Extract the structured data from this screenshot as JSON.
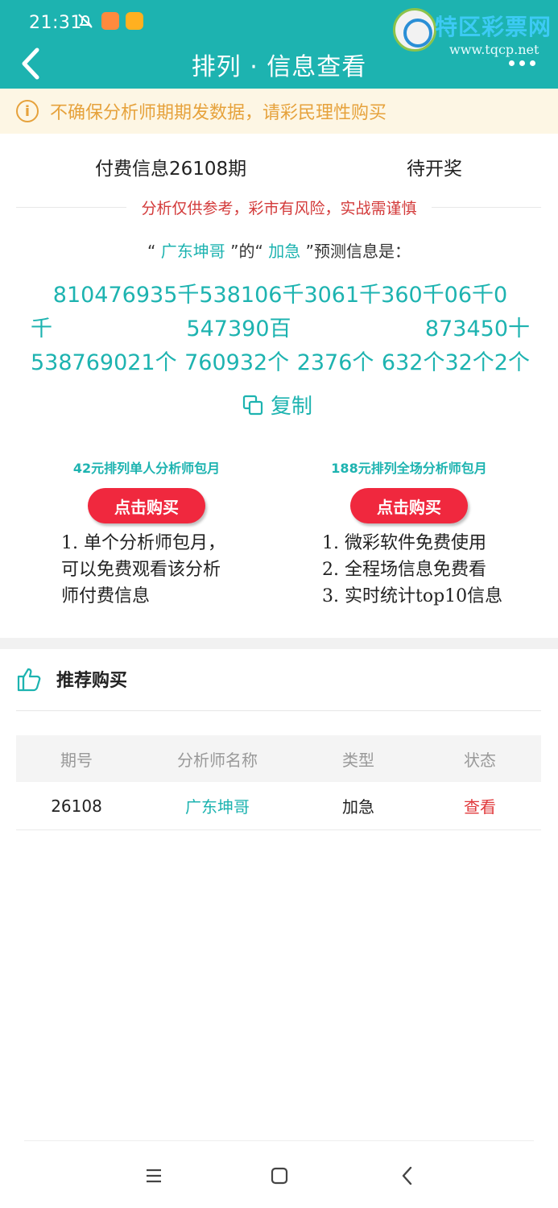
{
  "status_bar": {
    "time": "21:31"
  },
  "watermark": {
    "title": "特区彩票网",
    "url": "www.tqcp.net"
  },
  "nav": {
    "title": "排列 · 信息查看"
  },
  "notice": {
    "icon": "info-circle-icon",
    "text": "不确保分析师期期发数据，请彩民理性购买"
  },
  "info": {
    "title": "付费信息26108期",
    "status": "待开奖",
    "risk_text": "分析仅供参考，彩市有风险，实战需谨慎"
  },
  "predict": {
    "quote_open": "“",
    "analyst": "广东坤哥",
    "middle": "”的“",
    "type": "加急",
    "suffix": "”预测信息是："
  },
  "numbers": {
    "line1": [
      "810476935千538106千3061千360千06千0"
    ],
    "line2": [
      "千",
      "547390百",
      "873450十"
    ],
    "line3": [
      "538769021个",
      "760932个",
      "2376个",
      "632个32个2个"
    ]
  },
  "copy": {
    "label": "复制",
    "icon": "copy-icon"
  },
  "plans": [
    {
      "title": "42元排列单人分析师包月",
      "button": "点击购买",
      "desc": [
        "1. 单个分析师包月，",
        "可以免费观看该分析",
        "师付费信息"
      ]
    },
    {
      "title": "188元排列全场分析师包月",
      "button": "点击购买",
      "desc": [
        "1. 微彩软件免费使用",
        "2. 全程场信息免费看",
        "3. 实时统计top10信息"
      ]
    }
  ],
  "recommend": {
    "icon": "thumbs-up-icon",
    "title": "推荐购买",
    "columns": [
      "期号",
      "分析师名称",
      "类型",
      "状态"
    ],
    "rows": [
      {
        "issue": "26108",
        "analyst": "广东坤哥",
        "type": "加急",
        "status": "查看"
      }
    ]
  },
  "colors": {
    "primary": "#1db3b0",
    "warning": "#e6a23c",
    "buy_button": "#f0283e",
    "status_link": "#e0393b"
  }
}
